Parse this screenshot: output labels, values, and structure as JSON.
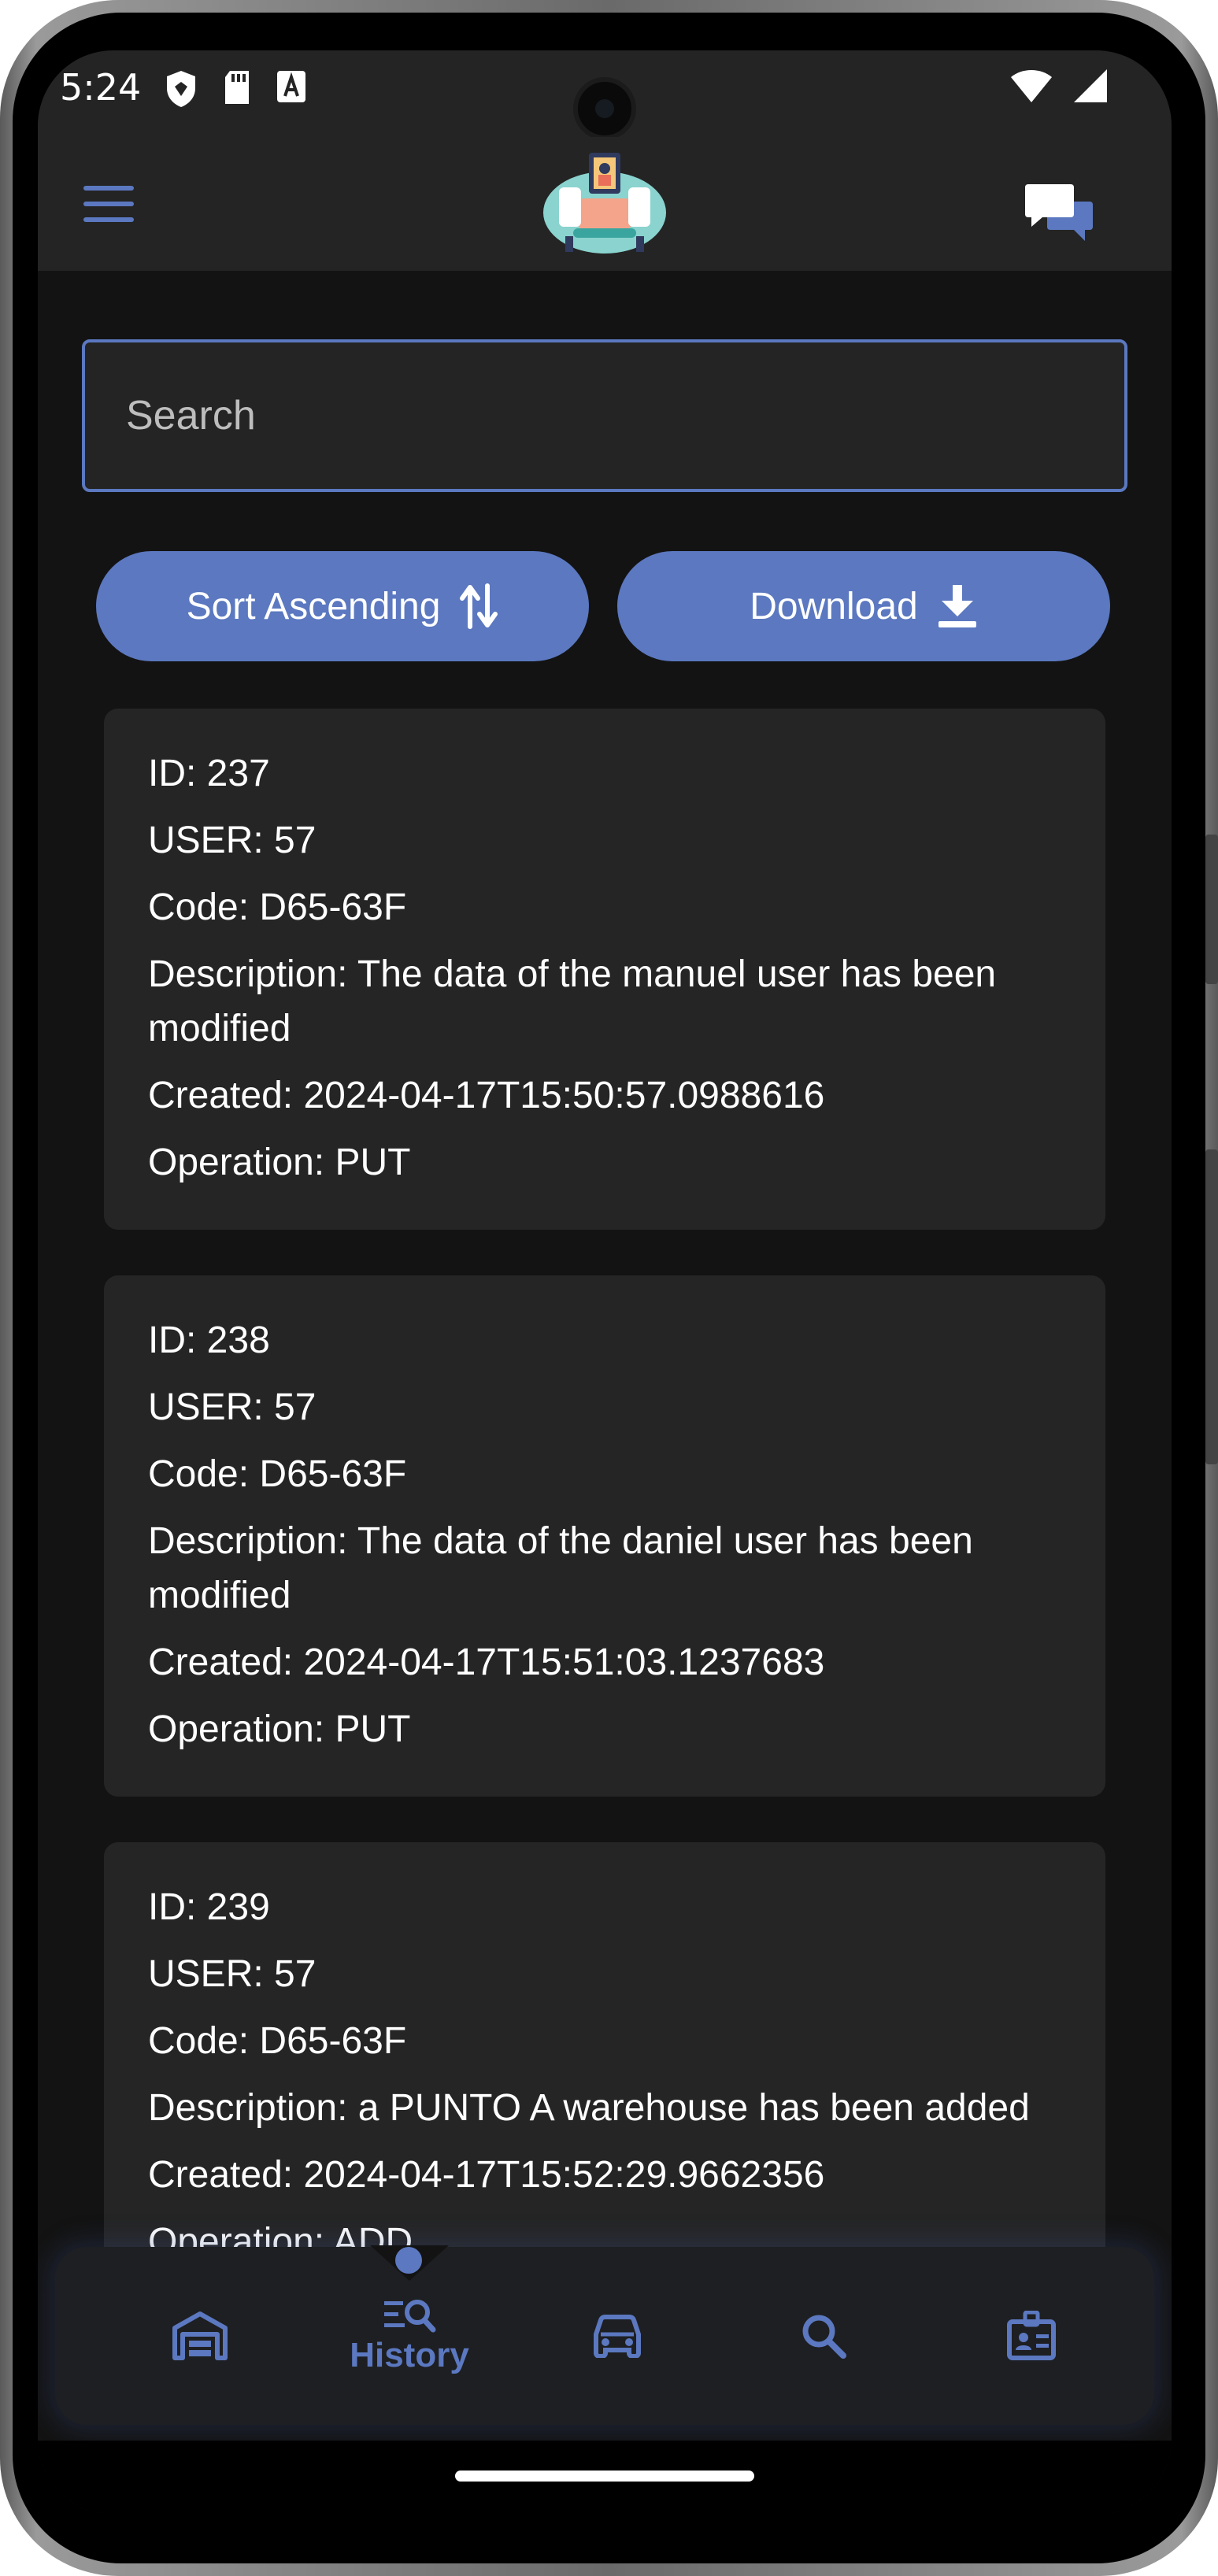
{
  "status_bar": {
    "time": "5:24"
  },
  "search": {
    "placeholder": "Search",
    "value": ""
  },
  "actions": {
    "sort_label": "Sort Ascending",
    "download_label": "Download"
  },
  "records": [
    {
      "id": "ID: 237",
      "user": "USER: 57",
      "code": "Code: D65-63F",
      "description": "Description: The data of the manuel user has been modified",
      "created": "Created: 2024-04-17T15:50:57.0988616",
      "operation": "Operation: PUT"
    },
    {
      "id": "ID: 238",
      "user": "USER: 57",
      "code": "Code: D65-63F",
      "description": "Description: The data of the daniel user has been modified",
      "created": "Created: 2024-04-17T15:51:03.1237683",
      "operation": "Operation: PUT"
    },
    {
      "id": "ID: 239",
      "user": "USER: 57",
      "code": "Code: D65-63F",
      "description": "Description: a PUNTO A warehouse has been added",
      "created": "Created: 2024-04-17T15:52:29.9662356",
      "operation": "Operation: ADD"
    }
  ],
  "bottom_nav": {
    "active_label": "History",
    "items": [
      "warehouse-icon",
      "history-icon",
      "car-icon",
      "search-icon",
      "badge-icon"
    ]
  },
  "colors": {
    "accent": "#5b78c0",
    "background": "#131313",
    "surface": "#252525",
    "appbar": "#242424"
  }
}
